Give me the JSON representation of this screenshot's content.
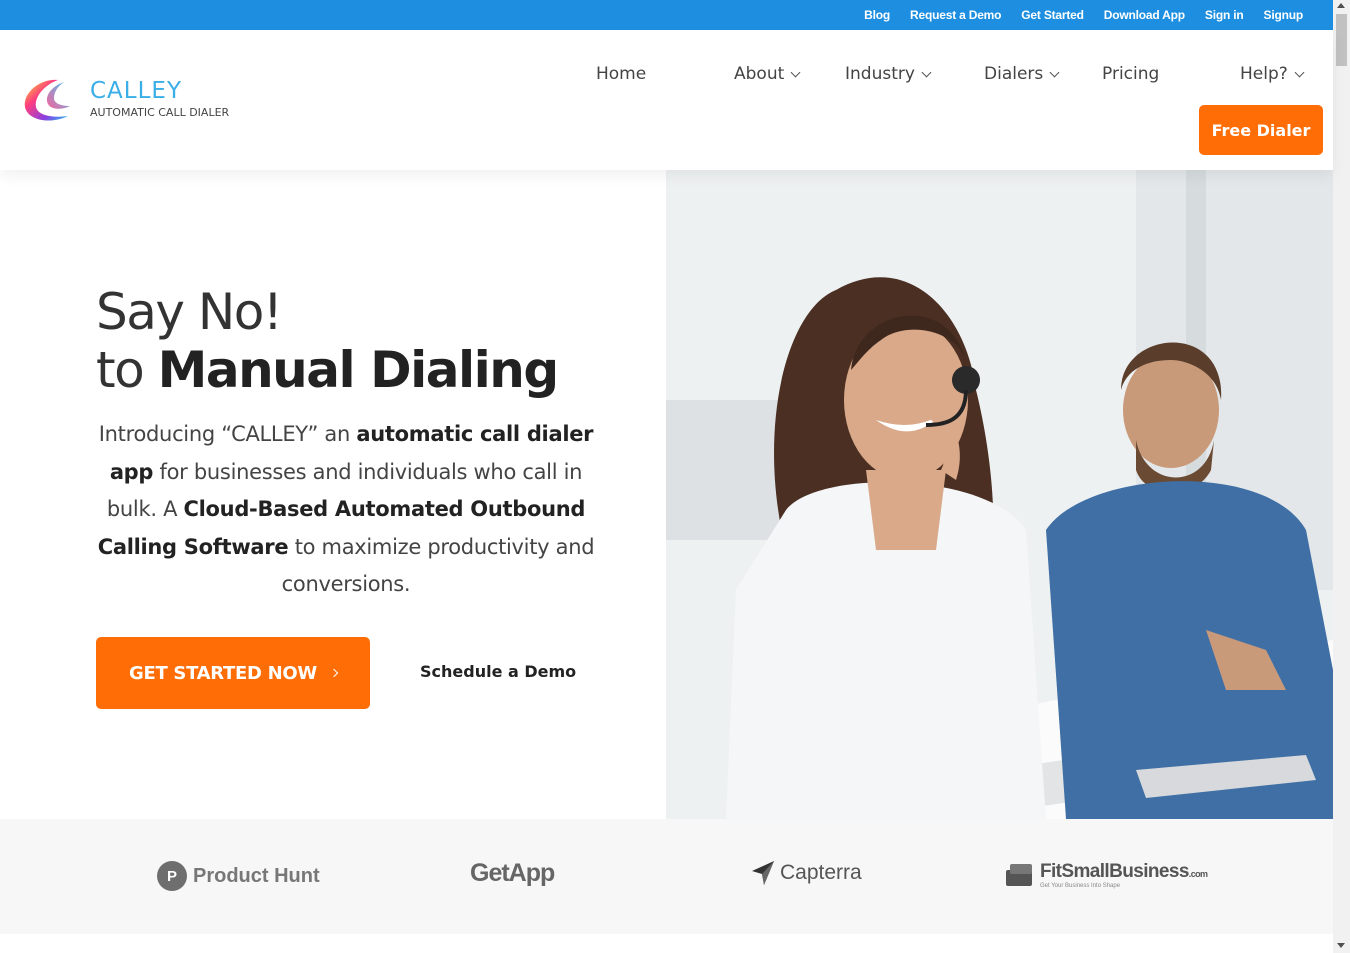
{
  "topbar": {
    "links": [
      "Blog",
      "Request a Demo",
      "Get Started",
      "Download App",
      "Sign in",
      "Signup"
    ],
    "background": "#1e8fe0"
  },
  "header": {
    "brand_name": "CALLEY",
    "brand_tagline": "AUTOMATIC CALL DIALER",
    "nav": {
      "home": "Home",
      "about": "About",
      "industry": "Industry",
      "dialers": "Dialers",
      "pricing": "Pricing",
      "help": "Help?"
    },
    "free_dialer_label": "Free Dialer"
  },
  "hero": {
    "title_line1": "Say No!",
    "title_line2_prefix": "to ",
    "title_line2_bold": "Manual Dialing",
    "intro_parts": {
      "p1": "Introducing “CALLEY” an ",
      "b1": "automatic call dialer app",
      "p2": " for businesses and individuals who call in bulk. A ",
      "b2": "Cloud-Based Automated Outbound Calling Software",
      "p3": " to maximize productivity and conversions."
    },
    "cta_label": "GET STARTED NOW",
    "demo_label": "Schedule a Demo",
    "accent_color": "#ff6d07"
  },
  "reviews": {
    "product_hunt_initial": "P",
    "product_hunt": "Product Hunt",
    "getapp": "GetApp",
    "capterra": "Capterra",
    "fitsmallbusiness": "FitSmallBusiness",
    "fitsmallbusiness_suffix": ".com",
    "fitsmallbusiness_tagline": "Get Your Business Into Shape"
  }
}
